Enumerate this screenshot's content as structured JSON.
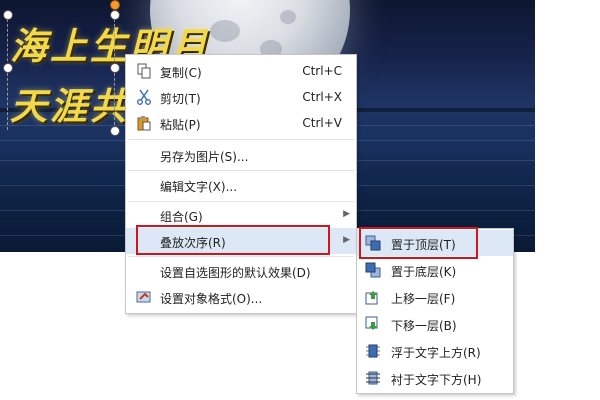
{
  "poem": {
    "line1": "海上生明月",
    "line2": "天涯共"
  },
  "context_menu": {
    "items": [
      {
        "label": "复制(C)",
        "shortcut": "Ctrl+C",
        "icon": "copy-icon"
      },
      {
        "label": "剪切(T)",
        "shortcut": "Ctrl+X",
        "icon": "cut-icon"
      },
      {
        "label": "粘贴(P)",
        "shortcut": "Ctrl+V",
        "icon": "paste-icon"
      },
      {
        "label": "另存为图片(S)..."
      },
      {
        "label": "编辑文字(X)..."
      },
      {
        "label": "组合(G)",
        "has_submenu": true
      },
      {
        "label": "叠放次序(R)",
        "has_submenu": true,
        "highlighted": true
      },
      {
        "label": "设置自选图形的默认效果(D)"
      },
      {
        "label": "设置对象格式(O)...",
        "icon": "format-object-icon"
      }
    ]
  },
  "submenu": {
    "items": [
      {
        "label": "置于顶层(T)",
        "icon": "bring-to-front-icon",
        "highlighted": true
      },
      {
        "label": "置于底层(K)",
        "icon": "send-to-back-icon"
      },
      {
        "label": "上移一层(F)",
        "icon": "bring-forward-icon"
      },
      {
        "label": "下移一层(B)",
        "icon": "send-backward-icon"
      },
      {
        "label": "浮于文字上方(R)",
        "icon": "in-front-of-text-icon"
      },
      {
        "label": "衬于文字下方(H)",
        "icon": "behind-text-icon"
      }
    ]
  },
  "colors": {
    "highlight": "#dce8f6",
    "annotation_box": "#d0161d",
    "poem_text": "#f1d94a"
  }
}
